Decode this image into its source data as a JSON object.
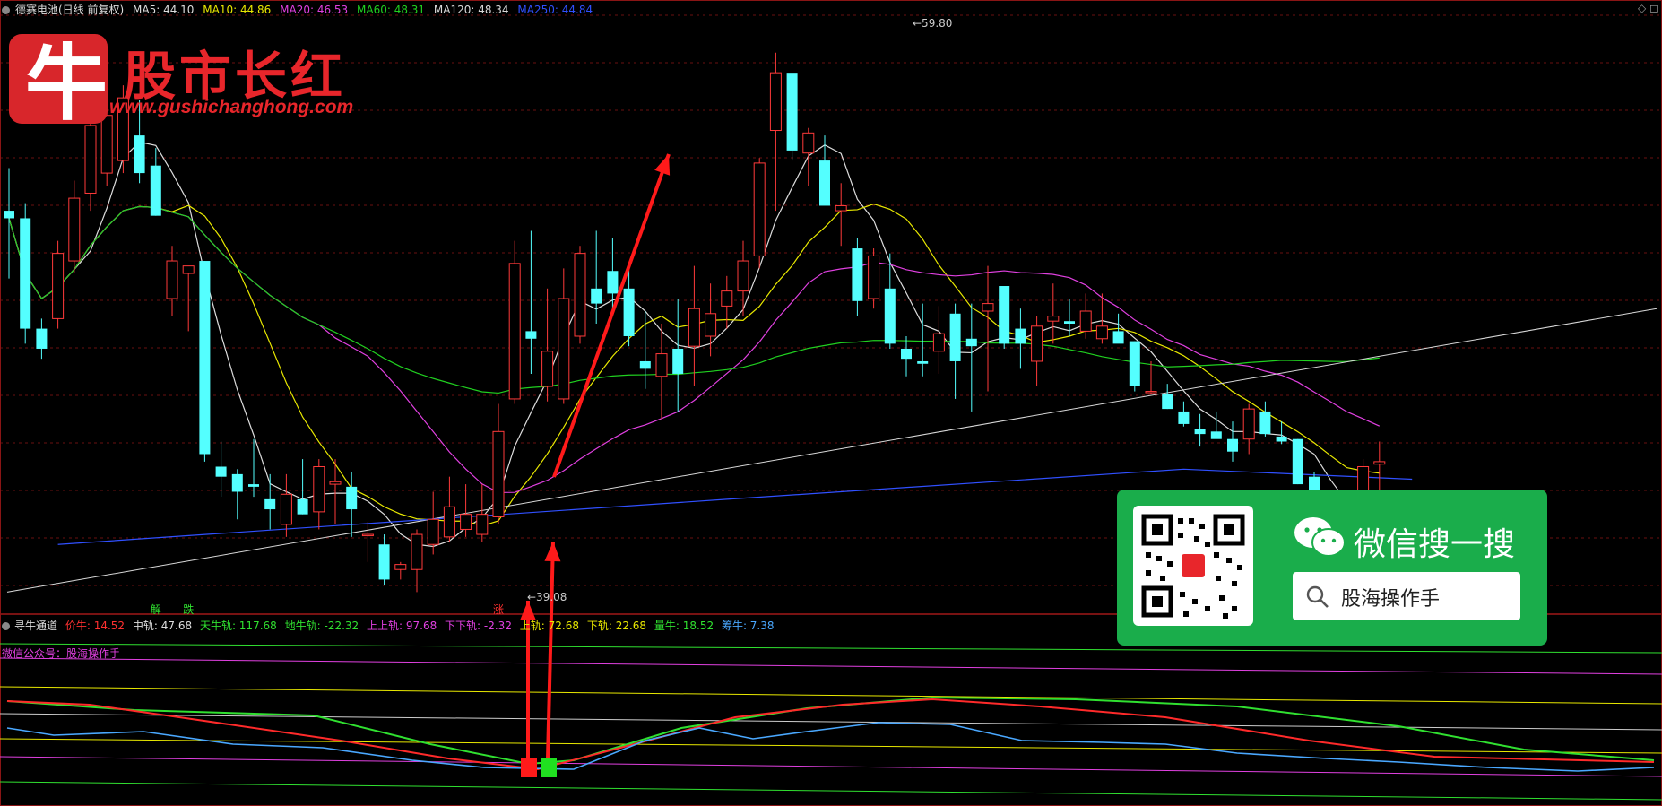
{
  "header": {
    "stock": "德赛电池(日线 前复权)",
    "ma": [
      {
        "label": "MA5: 44.10",
        "color": "#dddddd"
      },
      {
        "label": "MA10: 44.86",
        "color": "#e8e800"
      },
      {
        "label": "MA20: 46.53",
        "color": "#e040e0"
      },
      {
        "label": "MA60: 48.31",
        "color": "#20d020"
      },
      {
        "label": "MA120: 48.34",
        "color": "#d8d8d8"
      },
      {
        "label": "MA250: 44.84",
        "color": "#3050ff"
      }
    ]
  },
  "logo": {
    "char": "牛",
    "title": "股市长红",
    "url": "www.gushichanghong.com"
  },
  "wechat": {
    "title": "微信搜一搜",
    "search_text": "股海操作手"
  },
  "sub_header": {
    "name": "寻牛通道",
    "items": [
      {
        "label": "价牛: 14.52",
        "color": "#ff3030"
      },
      {
        "label": "中轨: 47.68",
        "color": "#dddddd"
      },
      {
        "label": "天牛轨: 117.68",
        "color": "#30e030"
      },
      {
        "label": "地牛轨: -22.32",
        "color": "#30e030"
      },
      {
        "label": "上上轨: 97.68",
        "color": "#e040e0"
      },
      {
        "label": "下下轨: -2.32",
        "color": "#e040e0"
      },
      {
        "label": "上轨: 72.68",
        "color": "#e8e800"
      },
      {
        "label": "下轨: 22.68",
        "color": "#e8e800"
      },
      {
        "label": "量牛: 18.52",
        "color": "#30e030"
      },
      {
        "label": "筹牛: 7.38",
        "color": "#4aa8ff"
      }
    ]
  },
  "note": {
    "text": "微信公众号：股海操作手",
    "color": "#e040e0"
  },
  "chart_data": {
    "type": "candlestick",
    "high_label": "59.80",
    "low_label": "39.08",
    "markers": [
      {
        "text": "解",
        "index": 9,
        "color": "#30e030"
      },
      {
        "text": "跌",
        "index": 11,
        "color": "#30e030"
      },
      {
        "text": "涨",
        "index": 30,
        "color": "#ff3030"
      }
    ],
    "ylim": [
      37.6,
      61.4
    ],
    "candles": [
      [
        53.5,
        55.2,
        50.8,
        53.2
      ],
      [
        53.2,
        53.8,
        48.2,
        48.8
      ],
      [
        48.8,
        49.2,
        47.6,
        48.0
      ],
      [
        49.2,
        52.3,
        48.8,
        51.8
      ],
      [
        51.5,
        54.7,
        51.0,
        54.0
      ],
      [
        54.2,
        57.8,
        53.5,
        56.9
      ],
      [
        55.0,
        58.1,
        54.5,
        57.3
      ],
      [
        55.5,
        58.5,
        55.0,
        58.0
      ],
      [
        56.5,
        57.9,
        54.6,
        55.0
      ],
      [
        55.3,
        56.0,
        53.3,
        53.3
      ],
      [
        50.0,
        52.1,
        49.3,
        51.5
      ],
      [
        51.0,
        51.2,
        48.7,
        51.3
      ],
      [
        51.5,
        51.5,
        43.5,
        43.8
      ],
      [
        43.3,
        44.3,
        42.1,
        42.9
      ],
      [
        43.0,
        43.2,
        41.2,
        42.3
      ],
      [
        42.6,
        44.4,
        42.1,
        42.5
      ],
      [
        42.0,
        43.0,
        40.8,
        41.6
      ],
      [
        41.0,
        43.0,
        40.5,
        42.2
      ],
      [
        42.0,
        43.6,
        41.4,
        41.4
      ],
      [
        41.5,
        43.6,
        40.8,
        43.3
      ],
      [
        42.6,
        43.6,
        41.0,
        42.7
      ],
      [
        42.5,
        43.1,
        40.5,
        41.6
      ],
      [
        40.6,
        41.1,
        39.5,
        40.6
      ],
      [
        40.2,
        40.6,
        38.6,
        38.8
      ],
      [
        39.2,
        39.5,
        38.8,
        39.4
      ],
      [
        39.2,
        40.8,
        38.3,
        40.6
      ],
      [
        40.2,
        42.3,
        39.8,
        41.2
      ],
      [
        40.5,
        42.9,
        40.3,
        41.7
      ],
      [
        40.8,
        42.6,
        40.5,
        41.4
      ],
      [
        40.6,
        42.6,
        40.3,
        41.4
      ],
      [
        41.3,
        45.8,
        41.0,
        44.7
      ],
      [
        46.0,
        52.3,
        45.8,
        51.4
      ],
      [
        48.7,
        52.7,
        47.0,
        48.4
      ],
      [
        46.5,
        50.4,
        45.9,
        47.9
      ],
      [
        46.0,
        51.2,
        45.8,
        50.0
      ],
      [
        48.5,
        52.1,
        48.2,
        51.8
      ],
      [
        50.4,
        52.7,
        49.0,
        49.8
      ],
      [
        51.1,
        52.4,
        49.6,
        50.2
      ],
      [
        50.4,
        51.3,
        48.1,
        48.5
      ],
      [
        47.5,
        49.5,
        46.4,
        47.2
      ],
      [
        46.9,
        49.0,
        45.2,
        47.8
      ],
      [
        48.0,
        50.0,
        45.5,
        47.0
      ],
      [
        48.1,
        51.3,
        46.5,
        49.6
      ],
      [
        48.5,
        50.6,
        47.7,
        49.4
      ],
      [
        49.7,
        50.9,
        48.8,
        50.3
      ],
      [
        50.3,
        52.3,
        49.3,
        51.5
      ],
      [
        51.7,
        55.6,
        51.2,
        55.4
      ],
      [
        56.7,
        59.8,
        53.5,
        59.0
      ],
      [
        59.0,
        58.9,
        55.5,
        55.9
      ],
      [
        55.8,
        56.8,
        54.5,
        56.6
      ],
      [
        55.5,
        56.5,
        53.8,
        53.7
      ],
      [
        53.5,
        54.6,
        52.1,
        53.7
      ],
      [
        52.0,
        52.4,
        49.3,
        49.9
      ],
      [
        50.0,
        52.0,
        49.6,
        51.7
      ],
      [
        50.4,
        51.8,
        48.0,
        48.2
      ],
      [
        48.0,
        48.5,
        46.9,
        47.6
      ],
      [
        47.5,
        49.8,
        46.9,
        47.4
      ],
      [
        47.9,
        49.7,
        47.0,
        48.6
      ],
      [
        49.4,
        49.8,
        46.0,
        47.5
      ],
      [
        48.4,
        49.8,
        45.5,
        48.1
      ],
      [
        49.5,
        51.3,
        46.3,
        49.8
      ],
      [
        50.5,
        49.1,
        48.0,
        48.2
      ],
      [
        48.8,
        49.6,
        47.2,
        48.2
      ],
      [
        47.5,
        49.3,
        46.5,
        48.9
      ],
      [
        49.1,
        50.6,
        48.2,
        49.3
      ],
      [
        49.1,
        50.0,
        48.5,
        49.0
      ],
      [
        48.7,
        50.2,
        48.4,
        49.5
      ],
      [
        48.4,
        50.2,
        48.2,
        48.9
      ],
      [
        48.7,
        49.4,
        48.3,
        48.2
      ],
      [
        48.3,
        48.3,
        46.3,
        46.5
      ],
      [
        46.3,
        47.5,
        46.2,
        46.3
      ],
      [
        46.2,
        46.6,
        45.6,
        45.6
      ],
      [
        45.5,
        45.9,
        44.9,
        45.0
      ],
      [
        44.8,
        45.4,
        44.1,
        44.6
      ],
      [
        44.7,
        45.5,
        44.6,
        44.4
      ],
      [
        44.4,
        45.1,
        43.5,
        43.9
      ],
      [
        44.4,
        45.8,
        43.8,
        45.6
      ],
      [
        45.5,
        45.9,
        44.5,
        44.6
      ],
      [
        44.5,
        45.1,
        44.2,
        44.3
      ],
      [
        44.4,
        44.4,
        42.6,
        42.6
      ],
      [
        42.9,
        43.1,
        41.9,
        41.9
      ],
      [
        41.9,
        42.2,
        40.5,
        40.5
      ],
      [
        40.0,
        41.0,
        39.7,
        40.2
      ],
      [
        40.2,
        43.6,
        40.1,
        43.3
      ],
      [
        43.4,
        44.3,
        42.3,
        43.5
      ]
    ]
  }
}
